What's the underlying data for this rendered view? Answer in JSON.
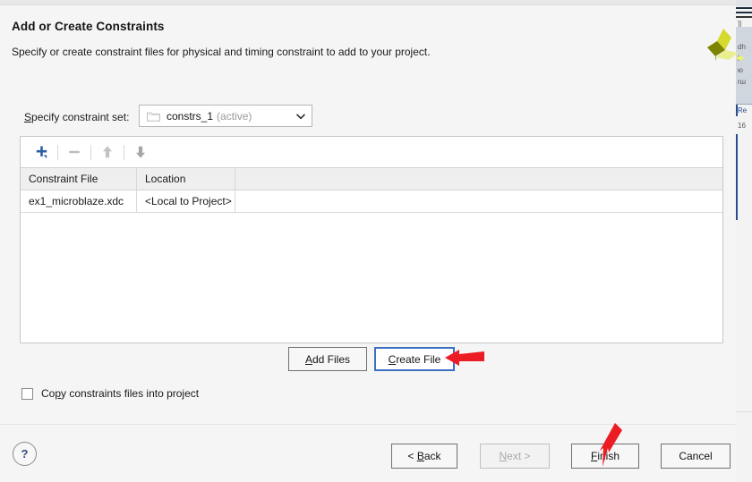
{
  "dialog": {
    "title": "Add or Create Constraints",
    "subtitle": "Specify or create constraint files for physical and timing constraint to add to your project.",
    "logo_name": "xilinx-logo",
    "logo_colors": [
      "#d6d92e",
      "#7c8400",
      "#e9ee8f"
    ]
  },
  "constraint_set": {
    "label_prefix": "S",
    "label_rest": "pecify constraint set:",
    "value": "constrs_1",
    "state": "(active)",
    "folder_icon": "folder-icon",
    "chevron_icon": "chevron-down-icon"
  },
  "toolbar": {
    "add_icon": "plus-icon",
    "remove_icon": "minus-icon",
    "move_up_icon": "arrow-up-icon",
    "move_down_icon": "arrow-down-icon",
    "add_color": "#2e5fa3",
    "disabled_color": "#bdbdbd",
    "enabled_color": "#9b9b9b"
  },
  "table": {
    "columns": [
      "Constraint File",
      "Location",
      ""
    ],
    "rows": [
      {
        "file": "ex1_microblaze.xdc",
        "location": "<Local to Project>",
        "extra": ""
      }
    ]
  },
  "actions": {
    "add_files": {
      "pre": "A",
      "post": "dd Files"
    },
    "create_file": {
      "pre": "C",
      "post": "reate File"
    }
  },
  "copy_option": {
    "checked": false,
    "part1": "Co",
    "part2": "p",
    "part3": "y constraints files into project"
  },
  "footer": {
    "help": "?",
    "back": {
      "pre": "< ",
      "key": "B",
      "post": "ack"
    },
    "next": {
      "pre": "",
      "key": "N",
      "post": "ext >"
    },
    "finish": {
      "pre": "",
      "key": "F",
      "post": "inish"
    },
    "cancel": {
      "pre": "",
      "key": "",
      "post": "Cancel"
    },
    "next_disabled": true
  },
  "annotations": {
    "arrow_color": "#ec1c24",
    "arrow_create_file_target": "create-file-button",
    "arrow_finish_target": "finish-button"
  },
  "background_strip": {
    "fragments": [
      "]|",
      "dh",
      "h",
      "ю",
      "rш",
      "Re",
      "16"
    ]
  }
}
